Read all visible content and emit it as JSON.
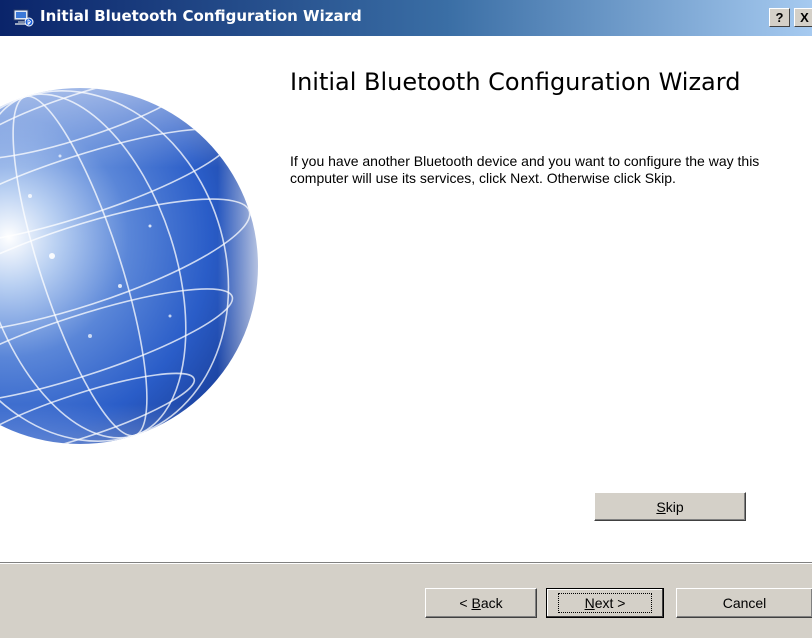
{
  "window": {
    "title": "Initial Bluetooth Configuration Wizard",
    "icon": "bluetooth-computer-icon",
    "help_label": "?",
    "close_label": "X"
  },
  "page": {
    "heading": "Initial Bluetooth Configuration Wizard",
    "description": "If you have another Bluetooth device and you want to configure the way this computer will use its services, click Next. Otherwise click Skip."
  },
  "buttons": {
    "skip": {
      "accel": "S",
      "rest": "kip"
    },
    "back": {
      "prefix": "< ",
      "accel": "B",
      "rest": "ack"
    },
    "next": {
      "accel": "N",
      "rest": "ext >"
    },
    "cancel": "Cancel"
  },
  "colors": {
    "titlebar_start": "#0a246a",
    "titlebar_end": "#a6caf0",
    "dialog_face": "#d4d0c8",
    "globe_blue": "#2a5dc8"
  }
}
